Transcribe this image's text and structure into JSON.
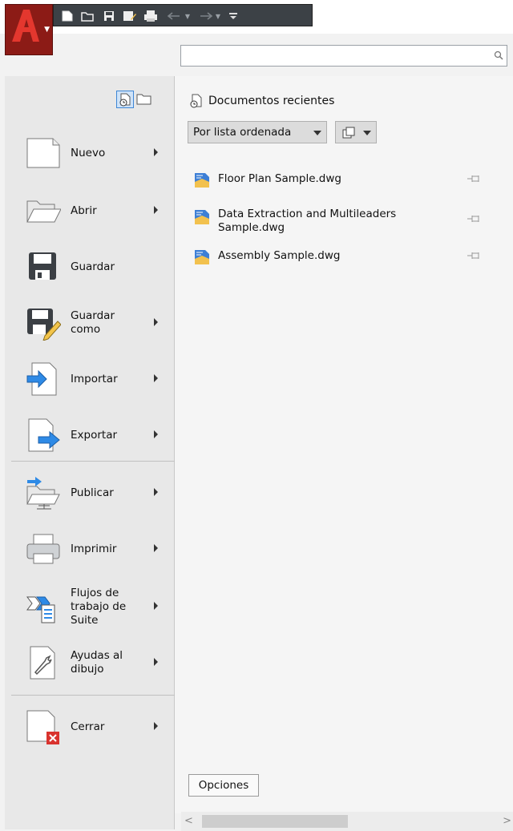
{
  "colors": {
    "app_button": "#8c1b16",
    "qat_background": "#3c4146",
    "left_column": "#e8e8e8",
    "right_panel": "#f5f5f5",
    "accent_blue": "#3d86d6",
    "close_red": "#d9332e"
  },
  "app_button": {
    "logo_letter": "A",
    "icon": "autocad-logo-icon"
  },
  "quick_access_toolbar": {
    "items": [
      "new-icon",
      "open-icon",
      "save-icon",
      "save-as-icon",
      "print-icon",
      "undo-icon",
      "redo-icon",
      "customize-icon"
    ]
  },
  "search": {
    "value": "",
    "placeholder": ""
  },
  "sidebar": {
    "view_toggles": [
      "recent-documents-icon",
      "open-documents-icon"
    ],
    "items": [
      {
        "label": "Nuevo",
        "icon": "new-document-icon",
        "has_submenu": true
      },
      {
        "label": "Abrir",
        "icon": "folder-open-icon",
        "has_submenu": true
      },
      {
        "label": "Guardar",
        "icon": "save-icon",
        "has_submenu": false
      },
      {
        "label": "Guardar como",
        "icon": "save-as-icon",
        "has_submenu": true
      },
      {
        "label": "Importar",
        "icon": "import-icon",
        "has_submenu": true
      },
      {
        "label": "Exportar",
        "icon": "export-icon",
        "has_submenu": true
      },
      {
        "label": "Publicar",
        "icon": "publish-icon",
        "has_submenu": true
      },
      {
        "label": "Imprimir",
        "icon": "print-icon",
        "has_submenu": true
      },
      {
        "label": "Flujos de trabajo de Suite",
        "icon": "suite-workflows-icon",
        "has_submenu": true
      },
      {
        "label": "Ayudas al dibujo",
        "icon": "drawing-utilities-icon",
        "has_submenu": true
      },
      {
        "label": "Cerrar",
        "icon": "close-document-icon",
        "has_submenu": true
      }
    ]
  },
  "recent": {
    "title": "Documentos recientes",
    "sort_label": "Por lista ordenada",
    "documents": [
      {
        "name": "Floor Plan Sample.dwg"
      },
      {
        "name": "Data Extraction and Multileaders Sample.dwg"
      },
      {
        "name": "Assembly Sample.dwg"
      }
    ]
  },
  "footer": {
    "options_label": "Opciones"
  }
}
